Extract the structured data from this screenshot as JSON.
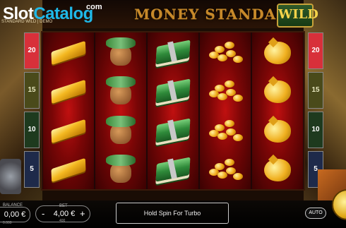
{
  "game": {
    "title": "MONEY STANDARD",
    "wild_badge": "WILD",
    "subtitle": "STANDARD WILD | DEMO"
  },
  "watermark": {
    "brand_slot": "Slot",
    "brand_catalog": "Catalog",
    "brand_com": "com"
  },
  "paylines": [
    "20",
    "15",
    "10",
    "5"
  ],
  "reels": [
    {
      "symbol": "gold-bar",
      "count": 4
    },
    {
      "symbol": "money-bag",
      "count": 4
    },
    {
      "symbol": "cash-stack",
      "count": 4
    },
    {
      "symbol": "gold-coins",
      "count": 4
    },
    {
      "symbol": "golden-piggy-bank",
      "count": 4
    }
  ],
  "bottom": {
    "balance_label": "BALANCE",
    "balance_value": "0,00 €",
    "balance_sub": "0.000",
    "bet_label": "BET",
    "bet_value": "4,00 €",
    "bet_sub": "400",
    "bet_minus": "-",
    "bet_plus": "+",
    "message": "Hold Spin For Turbo",
    "auto_label": "AUTO"
  },
  "colors": {
    "reel_red": "#c01010",
    "payline_20": "#d8303a",
    "brand_blue": "#1fb8e8",
    "title_gold": "#c7892a"
  }
}
